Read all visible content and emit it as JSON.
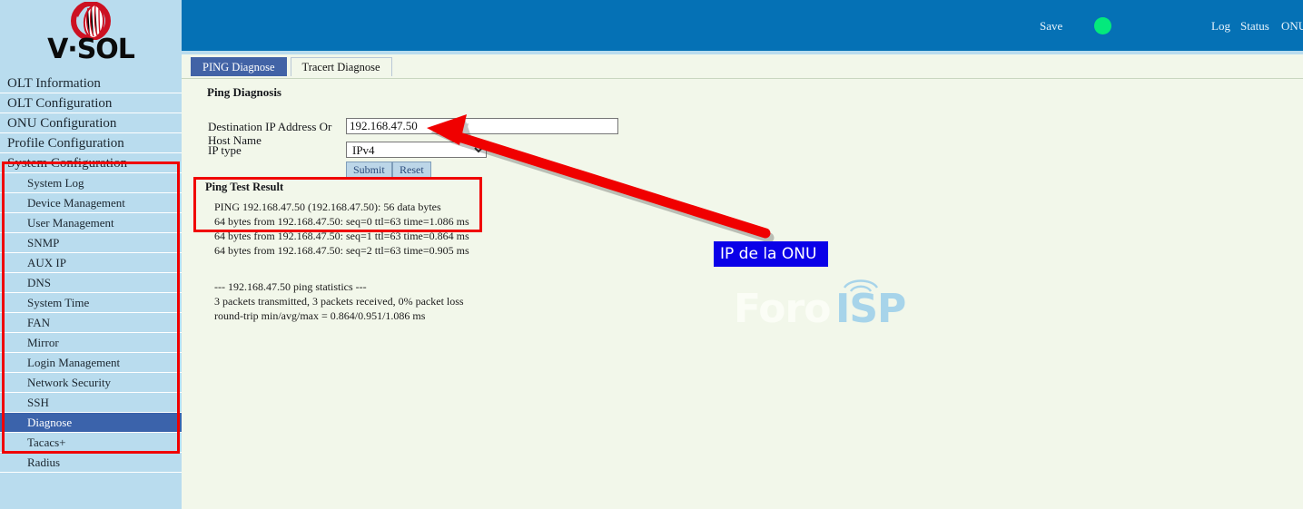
{
  "brand": {
    "name": "V·SOL",
    "logo_icon": "vsol-globe-icon"
  },
  "header": {
    "save_label": "Save",
    "status_dot_color": "#04e97c",
    "links": [
      {
        "label": "Log"
      },
      {
        "label": "Status"
      },
      {
        "label": "ONU"
      }
    ]
  },
  "sidebar": {
    "top_items": [
      {
        "label": "OLT Information"
      },
      {
        "label": "OLT Configuration"
      },
      {
        "label": "ONU Configuration"
      },
      {
        "label": "Profile Configuration"
      },
      {
        "label": "System Configuration"
      }
    ],
    "sub_items": [
      {
        "label": "System Log",
        "selected": false
      },
      {
        "label": "Device Management",
        "selected": false
      },
      {
        "label": "User Management",
        "selected": false
      },
      {
        "label": "SNMP",
        "selected": false
      },
      {
        "label": "AUX IP",
        "selected": false
      },
      {
        "label": "DNS",
        "selected": false
      },
      {
        "label": "System Time",
        "selected": false
      },
      {
        "label": "FAN",
        "selected": false
      },
      {
        "label": "Mirror",
        "selected": false
      },
      {
        "label": "Login Management",
        "selected": false
      },
      {
        "label": "Network Security",
        "selected": false
      },
      {
        "label": "SSH",
        "selected": false
      },
      {
        "label": "Diagnose",
        "selected": true
      },
      {
        "label": "Tacacs+",
        "selected": false
      },
      {
        "label": "Radius",
        "selected": false
      }
    ],
    "highlight_color": "#f00000"
  },
  "main": {
    "tabs": [
      {
        "label": "PING Diagnose",
        "active": true
      },
      {
        "label": "Tracert Diagnose",
        "active": false
      }
    ],
    "section_title": "Ping Diagnosis",
    "form": {
      "dest_label": "Destination IP Address Or Host Name",
      "dest_value": "192.168.47.50",
      "iptype_label": "IP type",
      "iptype_value": "IPv4",
      "iptype_options": [
        "IPv4"
      ],
      "submit_label": "Submit",
      "reset_label": "Reset"
    },
    "result": {
      "title": "Ping Test Result",
      "lines": "PING 192.168.47.50 (192.168.47.50): 56 data bytes\n64 bytes from 192.168.47.50: seq=0 ttl=63 time=1.086 ms\n64 bytes from 192.168.47.50: seq=1 ttl=63 time=0.864 ms\n64 bytes from 192.168.47.50: seq=2 ttl=63 time=0.905 ms",
      "stats": "--- 192.168.47.50 ping statistics ---\n3 packets transmitted, 3 packets received, 0% packet loss\nround-trip min/avg/max = 0.864/0.951/1.086 ms"
    }
  },
  "annotation": {
    "label": "IP de la ONU",
    "box_color": "#0a00e8",
    "arrow_color": "#f00000"
  },
  "watermark": {
    "part1": "Foro",
    "part2": "ISP",
    "icon": "wifi-signal-icon"
  }
}
